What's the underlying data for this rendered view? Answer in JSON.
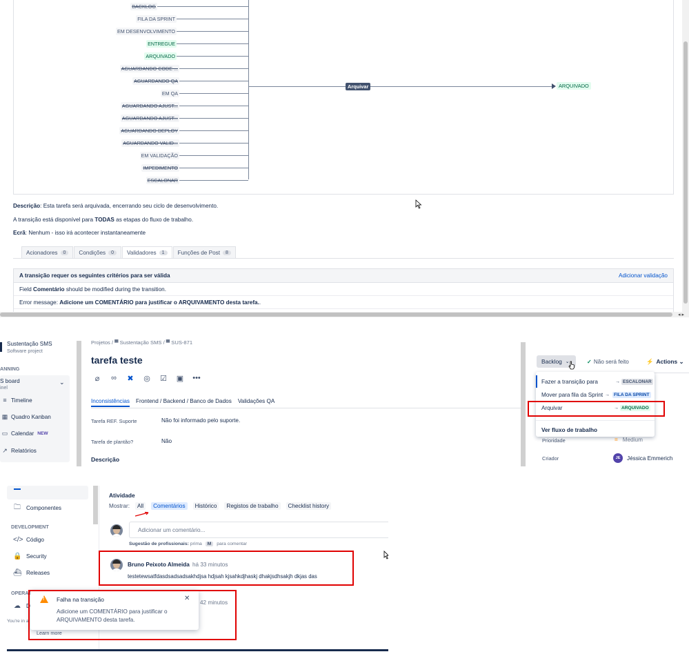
{
  "workflow": {
    "statuses": [
      {
        "label": "BACKLOG",
        "strike": true,
        "green": false
      },
      {
        "label": "FILA DA SPRINT",
        "strike": false,
        "green": false
      },
      {
        "label": "EM DESENVOLVIMENTO",
        "strike": false,
        "green": false
      },
      {
        "label": "ENTREGUE",
        "strike": false,
        "green": true
      },
      {
        "label": "ARQUIVADO",
        "strike": false,
        "green": true
      },
      {
        "label": "AGUARDANDO CODE ...",
        "strike": true,
        "green": false
      },
      {
        "label": "AGUARDANDO QA",
        "strike": true,
        "green": false
      },
      {
        "label": "EM QA",
        "strike": false,
        "green": false
      },
      {
        "label": "AGUARDANDO AJUST...",
        "strike": true,
        "green": false
      },
      {
        "label": "AGUARDANDO AJUST...",
        "strike": true,
        "green": false
      },
      {
        "label": "AGUARDANDO DEPLOY",
        "strike": true,
        "green": false
      },
      {
        "label": "AGUARDANDO VALID...",
        "strike": true,
        "green": false
      },
      {
        "label": "EM VALIDAÇÃO",
        "strike": false,
        "green": false
      },
      {
        "label": "IMPEDIMENTO",
        "strike": true,
        "green": false
      },
      {
        "label": "ESCALONAR",
        "strike": true,
        "green": false
      }
    ],
    "transition_label": "Arquivar",
    "target_status": "ARQUIVADO"
  },
  "transition_info": {
    "desc_label": "Descrição",
    "desc_text": ": Esta tarefa será arquivada, encerrando seu ciclo de desenvolvimento.",
    "avail_prefix": "A transição está disponível para ",
    "avail_bold": "TODAS",
    "avail_suffix": " as etapas do fluxo de trabalho.",
    "screen_label": "Ecrã",
    "screen_text": ": Nenhum - isso irá acontecer instantaneamente"
  },
  "tabs": [
    {
      "label": "Acionadores",
      "count": "0",
      "active": false
    },
    {
      "label": "Condições",
      "count": "0",
      "active": false
    },
    {
      "label": "Validadores",
      "count": "1",
      "active": true
    },
    {
      "label": "Funções de Post",
      "count": "8",
      "active": false
    }
  ],
  "validators": {
    "header": "A transição requer os seguintes critérios para ser válida",
    "add_link": "Adicionar validação",
    "row1_prefix": "Field ",
    "row1_bold": "Comentário",
    "row1_suffix": " should be modified during the transition.",
    "row2_prefix": "Error message: ",
    "row2_bold": "Adicione um COMENTÁRIO para justificar o ARQUIVAMENTO desta tarefa.",
    "row2_suffix": " ."
  },
  "issue": {
    "project_name": "Sustentação SMS",
    "project_type": "Software project",
    "planning": "ANNING",
    "board": "S board",
    "board_sub": "inel",
    "nav": [
      {
        "label": "Timeline",
        "icon": "timeline-icon",
        "glyph": "≡"
      },
      {
        "label": "Quadro Kanban",
        "icon": "kanban-icon",
        "glyph": "▦"
      },
      {
        "label": "Calendar",
        "icon": "calendar-icon",
        "glyph": "▭",
        "badge": "NEW"
      },
      {
        "label": "Relatórios",
        "icon": "reports-icon",
        "glyph": "↗"
      }
    ],
    "breadcrumb": "Projetos  /  ▀  Sustentação SMS  /  ▀  SUS-871",
    "title": "tarefa teste",
    "tabs": [
      {
        "label": "Inconsistências",
        "active": true
      },
      {
        "label": "Frontend / Backend / Banco de Dados",
        "active": false
      },
      {
        "label": "Validações QA",
        "active": false
      }
    ],
    "fields": [
      {
        "label": "Tarefa REF. Suporte",
        "value": "Não foi informado pelo suporte."
      },
      {
        "label": "Tarefa de plantão?",
        "value": "Não"
      }
    ],
    "description_label": "Descrição",
    "status_button": "Backlog",
    "wont_do": "Não será feito",
    "actions": "Actions",
    "menu": [
      {
        "label": "Fazer a transição para",
        "lozenge": "ESCALONAR",
        "style": "grey"
      },
      {
        "label": "Mover para fila da Sprint",
        "lozenge": "FILA DA SPRINT",
        "style": "blue"
      },
      {
        "label": "Arquivar",
        "lozenge": "ARQUIVADO",
        "style": "green"
      }
    ],
    "view_workflow": "Ver fluxo de trabalho",
    "priority_label": "Prioridade",
    "priority_value": "Medium",
    "creator_label": "Criador",
    "creator_initials": "JE",
    "creator_name": "Jéssica Emmerich"
  },
  "activity": {
    "side_nav": [
      {
        "label": "Componentes",
        "icon": "components-icon",
        "glyph": "🗀"
      },
      {
        "label": "Código",
        "icon": "code-icon",
        "glyph": "</>"
      },
      {
        "label": "Security",
        "icon": "lock-icon",
        "glyph": "🔒"
      },
      {
        "label": "Releases",
        "icon": "ship-icon",
        "glyph": "⛴"
      },
      {
        "label": "De",
        "icon": "deploy-icon",
        "glyph": "☁"
      }
    ],
    "development": "DEVELOPMENT",
    "operations": "OPERATIO",
    "youre": "You're in a",
    "title": "Atividade",
    "show_label": "Mostrar:",
    "filters": [
      {
        "label": "All",
        "active": false
      },
      {
        "label": "Comentários",
        "active": true
      },
      {
        "label": "Histórico",
        "active": false
      },
      {
        "label": "Registos de trabalho",
        "active": false
      },
      {
        "label": "Checklist history",
        "active": false
      }
    ],
    "comment_placeholder": "Adicionar um comentário...",
    "tip_bold": "Sugestão de profissionais:",
    "tip_press": " prima ",
    "tip_key": "M",
    "tip_suffix": " para comentar",
    "author": "Bruno Peixoto Almeida",
    "time": "há 33 minutos",
    "body": "testetewsatfdasdsadsadsakhdjsa hdjsah kjsahkdjhaskj dhakjsdhsakjh dkjas das",
    "time2": "42 minutos",
    "flag_title": "Falha na transição",
    "flag_message": "Adicione um COMENTÁRIO para justificar o ARQUIVAMENTO desta tarefa.",
    "learn_more": "Learn more"
  },
  "colors": {
    "accent": "#0052cc",
    "highlight": "#e00000",
    "warning": "#ff8b00",
    "success": "#00875a"
  }
}
